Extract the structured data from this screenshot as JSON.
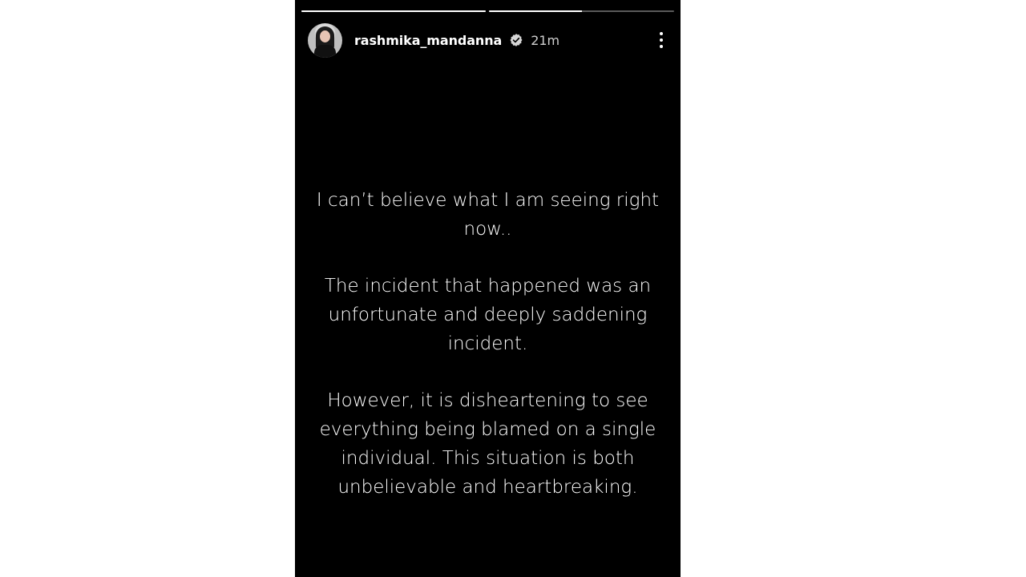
{
  "story": {
    "username": "rashmika_mandanna",
    "time_ago": "21m",
    "verified_icon": "verified-badge-icon",
    "more_icon": "more-options-icon",
    "progress": [
      1.0,
      0.5
    ],
    "paragraphs": [
      "I can’t believe what I am seeing right now..",
      "The incident that happened was an unfortunate and deeply saddening incident.",
      "However, it is disheartening to see everything being blamed on a single individual. This situation is both unbelievable and heartbreaking."
    ]
  },
  "colors": {
    "story_background": "#000000",
    "page_background": "#ffffff",
    "text": "#ffffff"
  }
}
